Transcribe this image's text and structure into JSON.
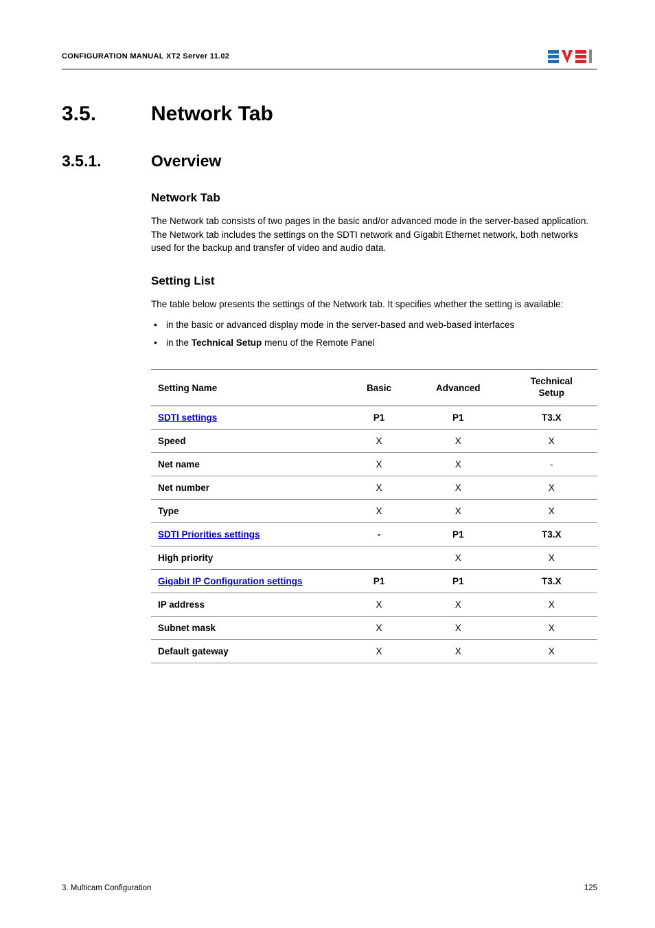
{
  "header": {
    "left": "CONFIGURATION MANUAL  XT2 Server 11.02"
  },
  "section": {
    "h1_num": "3.5.",
    "h1_title": "Network Tab",
    "h2_num": "3.5.1.",
    "h2_title": "Overview"
  },
  "block1": {
    "heading": "Network Tab",
    "para": "The Network tab consists of two pages in the basic and/or advanced mode in the server-based application. The Network tab includes the settings on the SDTI network and Gigabit Ethernet network, both networks used for the backup and transfer of video and audio data."
  },
  "block2": {
    "heading": "Setting List",
    "para": "The table below presents the settings of the Network tab. It specifies whether the setting is available:",
    "bullets": [
      "in the basic or advanced display mode in the server-based and web-based interfaces",
      "in the Technical Setup menu of the Remote Panel"
    ],
    "bullet_bold_prefix": "Technical Setup"
  },
  "table": {
    "headers": {
      "name": "Setting Name",
      "basic": "Basic",
      "advanced": "Advanced",
      "tech1": "Technical",
      "tech2": "Setup"
    },
    "rows": [
      {
        "name": "SDTI settings",
        "link": true,
        "basic": "P1",
        "advanced": "P1",
        "tech": "T3.X",
        "bold_row": true
      },
      {
        "name": "Speed",
        "link": false,
        "basic": "X",
        "advanced": "X",
        "tech": "X"
      },
      {
        "name": "Net name",
        "link": false,
        "basic": "X",
        "advanced": "X",
        "tech": "-"
      },
      {
        "name": "Net number",
        "link": false,
        "basic": "X",
        "advanced": "X",
        "tech": "X"
      },
      {
        "name": "Type",
        "link": false,
        "basic": "X",
        "advanced": "X",
        "tech": "X"
      },
      {
        "name": "SDTI Priorities settings",
        "link": true,
        "basic": "-",
        "advanced": "P1",
        "tech": "T3.X",
        "bold_row": true
      },
      {
        "name": "High priority",
        "link": false,
        "basic": "",
        "advanced": "X",
        "tech": "X"
      },
      {
        "name": "Gigabit IP Configuration settings",
        "link": true,
        "basic": "P1",
        "advanced": "P1",
        "tech": "T3.X",
        "bold_row": true
      },
      {
        "name": "IP address",
        "link": false,
        "basic": "X",
        "advanced": "X",
        "tech": "X"
      },
      {
        "name": "Subnet mask",
        "link": false,
        "basic": "X",
        "advanced": "X",
        "tech": "X"
      },
      {
        "name": "Default gateway",
        "link": false,
        "basic": "X",
        "advanced": "X",
        "tech": "X"
      }
    ]
  },
  "footer": {
    "left": "3. Multicam Configuration",
    "right": "125"
  }
}
